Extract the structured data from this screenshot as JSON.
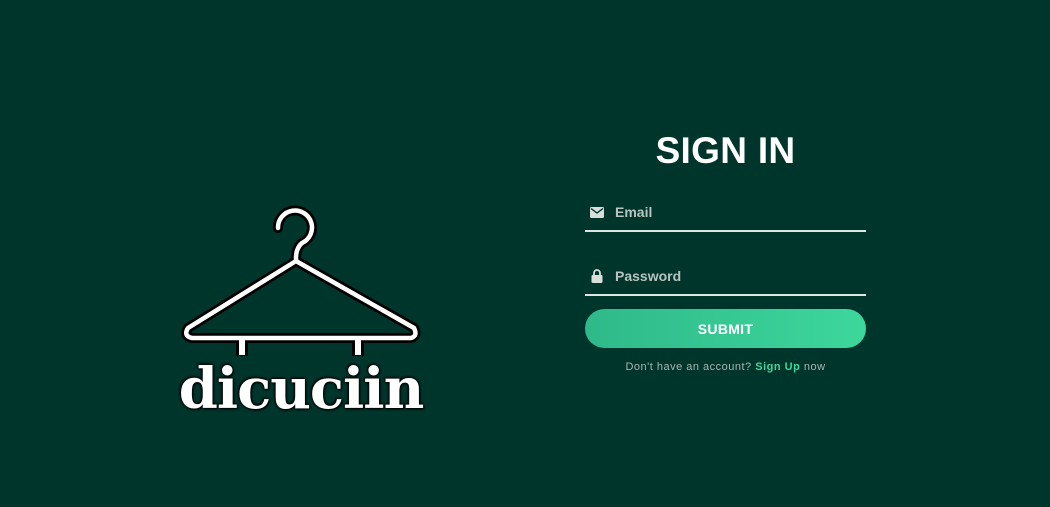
{
  "brand": {
    "name": "dicuciin",
    "logo_icon": "clothes-hanger-icon"
  },
  "form": {
    "title": "SIGN IN",
    "email": {
      "placeholder": "Email",
      "value": "",
      "icon": "envelope-icon"
    },
    "password": {
      "placeholder": "Password",
      "value": "",
      "icon": "lock-icon"
    },
    "submit_label": "SUBMIT",
    "signup_prefix": "Don't have an account?",
    "signup_link": "Sign Up",
    "signup_suffix": "now"
  },
  "colors": {
    "background": "#00352c",
    "accent": "#3dd79c",
    "text": "#ffffff"
  }
}
